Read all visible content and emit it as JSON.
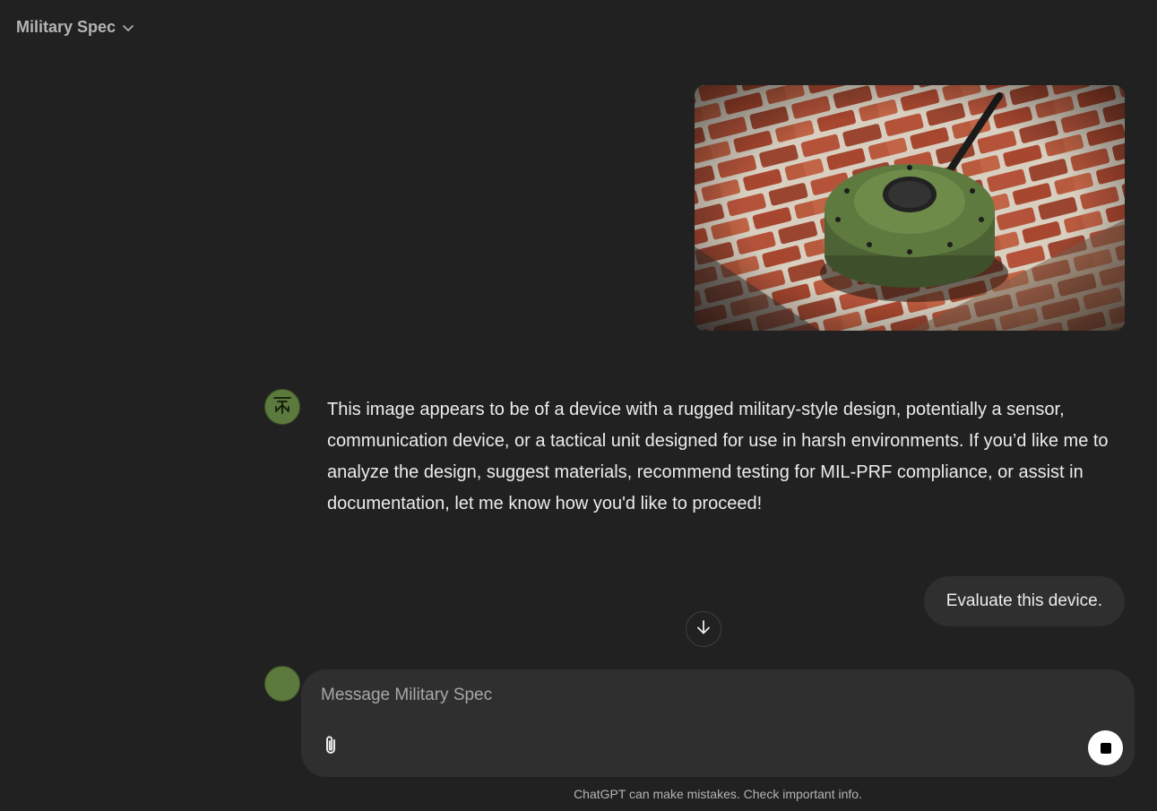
{
  "header": {
    "model_name": "Military Spec",
    "dropdown_icon": "chevron-down-icon"
  },
  "conversation": {
    "user_image": {
      "alt": "image"
    },
    "assistant_message": "This image appears to be of a device with a rugged military-style design, potentially a sensor, communication device, or a tactical unit designed for use in harsh environments. If you’d like me to analyze the design, suggest materials, recommend testing for MIL-PRF compliance, or assist in documentation, let me know how you'd like to proceed!",
    "user_message": "Evaluate this device."
  },
  "scroll": {
    "icon": "arrow-down-icon"
  },
  "composer": {
    "placeholder": "Message Military Spec",
    "value": "",
    "attach_icon": "paperclip-icon",
    "stop_icon": "stop-icon"
  },
  "footer": {
    "disclaimer": "ChatGPT can make mistakes. Check important info."
  },
  "colors": {
    "background": "#212121",
    "bubble": "#2f2f2f",
    "text": "#ececec",
    "muted": "#b4b4b4",
    "avatar": "#5c7a3d"
  }
}
